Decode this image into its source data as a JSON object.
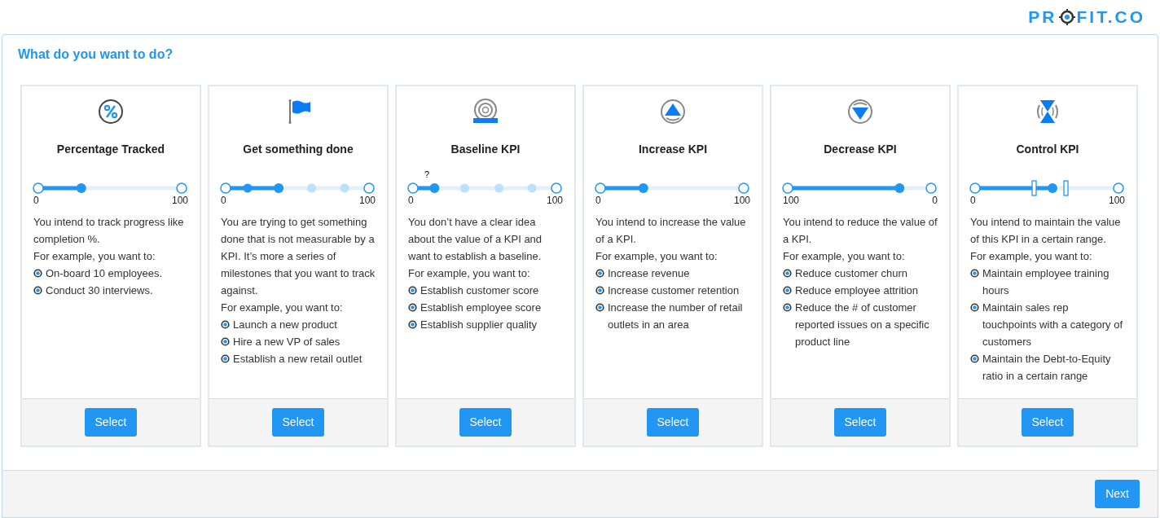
{
  "logo": {
    "before": "PR",
    "after": "FIT.CO"
  },
  "heading": "What do you want to do?",
  "cards": [
    {
      "kind": "percent",
      "title": "Percentage Tracked",
      "slider": {
        "kind": "single",
        "level": 0.3,
        "left_label": "0",
        "right_label": "100"
      },
      "intro": "You intend to track progress like completion %.",
      "example_label": "For example, you want to:",
      "examples": [
        "On-board 10 employees.",
        "Conduct 30 interviews."
      ],
      "button": "Select"
    },
    {
      "kind": "flag",
      "title": "Get something done",
      "slider": {
        "kind": "milestones",
        "level": 0.37,
        "left_label": "0",
        "right_label": "100"
      },
      "intro": "You are trying to get something done that is not measurable by a KPI. It’s more a series of milestones that you want to track against.",
      "example_label": "For example, you want to:",
      "examples": [
        "Launch a new product",
        "Hire a new VP of sales",
        "Establish a new retail outlet"
      ],
      "button": "Select"
    },
    {
      "kind": "baseline",
      "title": "Baseline KPI",
      "slider": {
        "kind": "baseline",
        "level": 0.15,
        "left_label": "0",
        "right_label": "100",
        "marker": "?"
      },
      "intro": "You don’t have a clear idea about the value of a KPI and want to establish a baseline.",
      "example_label": "For example, you want to:",
      "examples": [
        "Establish customer score",
        "Establish employee score",
        "Establish supplier quality"
      ],
      "button": "Select"
    },
    {
      "kind": "increase",
      "title": "Increase KPI",
      "slider": {
        "kind": "single",
        "level": 0.3,
        "left_label": "0",
        "right_label": "100"
      },
      "intro": "You intend to increase the value of a KPI.",
      "example_label": "For example, you want to:",
      "examples": [
        "Increase revenue",
        "Increase customer retention",
        "Increase the number of retail outlets in an area"
      ],
      "button": "Select"
    },
    {
      "kind": "decrease",
      "title": "Decrease KPI",
      "slider": {
        "kind": "single",
        "level": 0.78,
        "left_label": "100",
        "right_label": "0"
      },
      "intro": "You intend to reduce the value of a KPI.",
      "example_label": "For example, you want to:",
      "examples": [
        "Reduce customer churn",
        "Reduce employee attrition",
        "Reduce the # of customer reported issues on a specific product line"
      ],
      "button": "Select"
    },
    {
      "kind": "control",
      "title": "Control KPI",
      "slider": {
        "kind": "range",
        "level": 0.54,
        "left_label": "0",
        "right_label": "100"
      },
      "intro": "You intend to maintain the value of this KPI in a certain range.",
      "example_label": "For example, you want to:",
      "examples": [
        "Maintain employee training hours",
        "Maintain sales rep touchpoints with a category of customers",
        "Maintain the Debt-to-Equity ratio in a certain range"
      ],
      "button": "Select"
    }
  ],
  "next_button": "Next"
}
